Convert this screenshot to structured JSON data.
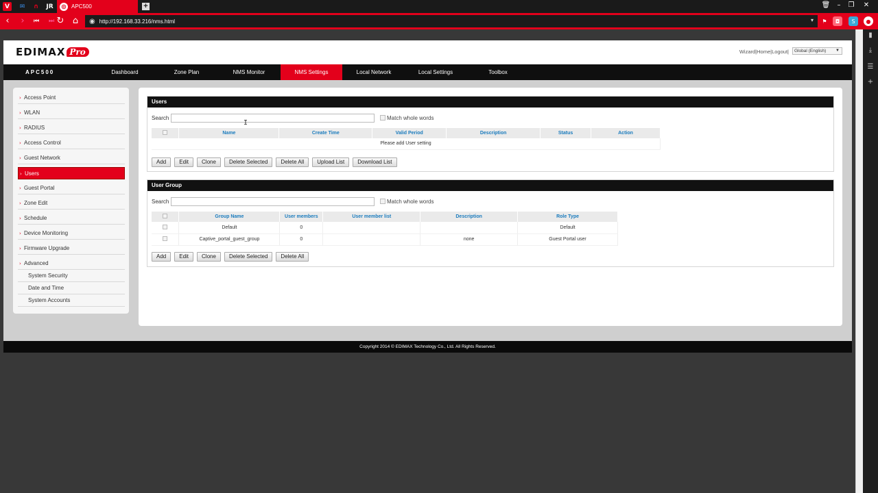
{
  "browser": {
    "tab_title": "APC500",
    "url": "http://192.168.33.216/nms.html",
    "tab_icons": [
      "vivaldi-icon",
      "mail-icon",
      "arch-icon",
      "jr-icon"
    ],
    "tab_jr_label": "JR",
    "new_tab_label": "+",
    "url_dropdown": "▾"
  },
  "header": {
    "brand": "EDIMAX",
    "brand_suffix": "Pro",
    "links": {
      "wizard": "Wizard",
      "home": "Home",
      "logout": "Logout",
      "sep": " | "
    },
    "language": "Global (English)",
    "language_caret": "▼"
  },
  "nav": {
    "device": "APC500",
    "items": [
      "Dashboard",
      "Zone Plan",
      "NMS Monitor",
      "NMS Settings",
      "Local Network",
      "Local Settings",
      "Toolbox"
    ],
    "active": "NMS Settings"
  },
  "sidebar": {
    "items": [
      {
        "label": "Access Point"
      },
      {
        "label": "WLAN"
      },
      {
        "label": "RADIUS"
      },
      {
        "label": "Access Control"
      },
      {
        "label": "Guest Network"
      },
      {
        "label": "Users"
      },
      {
        "label": "Guest Portal"
      },
      {
        "label": "Zone Edit"
      },
      {
        "label": "Schedule"
      },
      {
        "label": "Device Monitoring"
      },
      {
        "label": "Firmware Upgrade"
      },
      {
        "label": "Advanced"
      }
    ],
    "subitems": [
      {
        "label": "System Security"
      },
      {
        "label": "Date and Time"
      },
      {
        "label": "System Accounts"
      }
    ],
    "active": "Users"
  },
  "users_panel": {
    "title": "Users",
    "search_label": "Search",
    "search_value": "",
    "match_label": "Match whole words",
    "columns": [
      "Name",
      "Create Time",
      "Valid Period",
      "Description",
      "Status",
      "Action"
    ],
    "empty_message": "Please add User setting",
    "buttons": [
      "Add",
      "Edit",
      "Clone",
      "Delete Selected",
      "Delete All",
      "Upload List",
      "Download List"
    ]
  },
  "group_panel": {
    "title": "User Group",
    "search_label": "Search",
    "search_value": "",
    "match_label": "Match whole words",
    "columns": [
      "Group Name",
      "User members",
      "User member list",
      "Description",
      "Role Type"
    ],
    "rows": [
      {
        "group_name": "Default",
        "members": "0",
        "member_list": "",
        "description": "",
        "role_type": "Default"
      },
      {
        "group_name": "Captive_portal_guest_group",
        "members": "0",
        "member_list": "",
        "description": "none",
        "role_type": "Guest Portal user"
      }
    ],
    "buttons": [
      "Add",
      "Edit",
      "Clone",
      "Delete Selected",
      "Delete All"
    ]
  },
  "footer": {
    "copyright": "Copyright 2014 © EDIMAX Technology Co., Ltd. All Rights Reserved."
  },
  "colors": {
    "accent": "#e3001b",
    "nav_bg": "#0f0f0f",
    "header_link": "#1a7bbd"
  }
}
